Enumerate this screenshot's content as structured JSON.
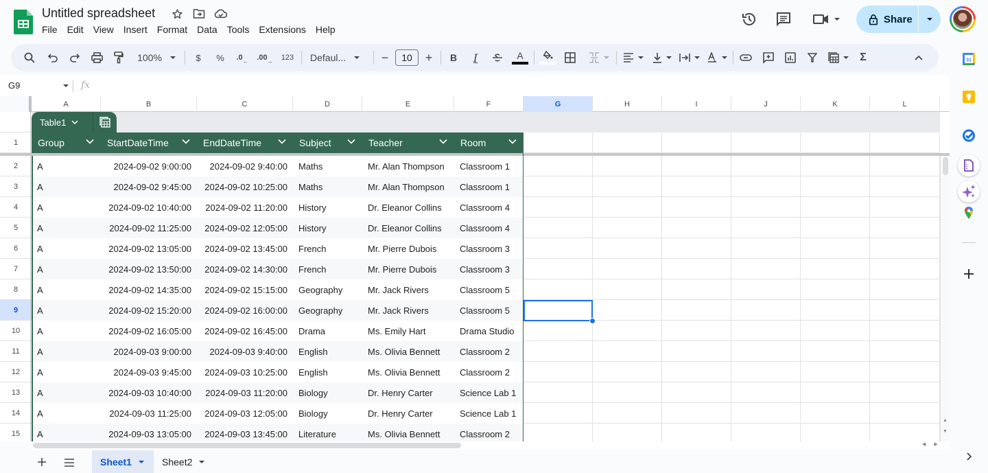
{
  "app": {
    "title": "Untitled spreadsheet",
    "menu": [
      "File",
      "Edit",
      "View",
      "Insert",
      "Format",
      "Data",
      "Tools",
      "Extensions",
      "Help"
    ],
    "share_label": "Share",
    "icons": [
      "sheets-logo-icon",
      "star-icon",
      "move-to-folder-icon",
      "cloud-saved-icon",
      "version-history-icon",
      "comments-icon",
      "meet-icon",
      "lock-icon",
      "avatar"
    ]
  },
  "toolbar": {
    "zoom": "100%",
    "currency": "$",
    "percent": "%",
    "decrease_decimal": ".0",
    "increase_decimal": ".00",
    "format_more": "123",
    "font": "Defaul...",
    "font_size": "10",
    "minus": "−",
    "plus": "+",
    "bold": "B",
    "italic": "I",
    "text_color": "A",
    "sum": "Σ"
  },
  "formula_bar": {
    "name_box": "G9",
    "fx": "fx",
    "value": ""
  },
  "grid": {
    "columns": [
      "A",
      "B",
      "C",
      "D",
      "E",
      "F",
      "G",
      "H",
      "I",
      "J",
      "K",
      "L"
    ],
    "selected_column": "G",
    "selected_row": "9",
    "selected_cell": "G9",
    "row_numbers": [
      "1",
      "2",
      "3",
      "4",
      "5",
      "6",
      "7",
      "8",
      "9",
      "10",
      "11",
      "12",
      "13",
      "14",
      "15"
    ],
    "table_name": "Table1",
    "table_color": "#356853",
    "headers": [
      "Group",
      "StartDateTime",
      "EndDateTime",
      "Subject",
      "Teacher",
      "Room"
    ],
    "rows": [
      [
        "A",
        "2024-09-02 9:00:00",
        "2024-09-02 9:40:00",
        "Maths",
        "Mr. Alan Thompson",
        "Classroom 1"
      ],
      [
        "A",
        "2024-09-02 9:45:00",
        "2024-09-02 10:25:00",
        "Maths",
        "Mr. Alan Thompson",
        "Classroom 1"
      ],
      [
        "A",
        "2024-09-02 10:40:00",
        "2024-09-02 11:20:00",
        "History",
        "Dr. Eleanor Collins",
        "Classroom 4"
      ],
      [
        "A",
        "2024-09-02 11:25:00",
        "2024-09-02 12:05:00",
        "History",
        "Dr. Eleanor Collins",
        "Classroom 4"
      ],
      [
        "A",
        "2024-09-02 13:05:00",
        "2024-09-02 13:45:00",
        "French",
        "Mr. Pierre Dubois",
        "Classroom 3"
      ],
      [
        "A",
        "2024-09-02 13:50:00",
        "2024-09-02 14:30:00",
        "French",
        "Mr. Pierre Dubois",
        "Classroom 3"
      ],
      [
        "A",
        "2024-09-02 14:35:00",
        "2024-09-02 15:15:00",
        "Geography",
        "Mr. Jack Rivers",
        "Classroom 5"
      ],
      [
        "A",
        "2024-09-02 15:20:00",
        "2024-09-02 16:00:00",
        "Geography",
        "Mr. Jack Rivers",
        "Classroom 5"
      ],
      [
        "A",
        "2024-09-02 16:05:00",
        "2024-09-02 16:45:00",
        "Drama",
        "Ms. Emily Hart",
        "Drama Studio"
      ],
      [
        "A",
        "2024-09-03 9:00:00",
        "2024-09-03 9:40:00",
        "English",
        "Ms. Olivia Bennett",
        "Classroom 2"
      ],
      [
        "A",
        "2024-09-03 9:45:00",
        "2024-09-03 10:25:00",
        "English",
        "Ms. Olivia Bennett",
        "Classroom 2"
      ],
      [
        "A",
        "2024-09-03 10:40:00",
        "2024-09-03 11:20:00",
        "Biology",
        "Dr. Henry Carter",
        "Science Lab 1"
      ],
      [
        "A",
        "2024-09-03 11:25:00",
        "2024-09-03 12:05:00",
        "Biology",
        "Dr. Henry Carter",
        "Science Lab 1"
      ],
      [
        "A",
        "2024-09-03 13:05:00",
        "2024-09-03 13:45:00",
        "Literature",
        "Ms. Olivia Bennett",
        "Classroom 2"
      ]
    ]
  },
  "sheets": {
    "tabs": [
      "Sheet1",
      "Sheet2"
    ],
    "active": "Sheet1"
  },
  "side_panel": {
    "apps": [
      "calendar-icon",
      "keep-icon",
      "tasks-icon",
      "forms-icon",
      "gemini-icon",
      "maps-icon",
      "add-icon"
    ]
  },
  "colors": {
    "accent": "#0b57d0",
    "share_bg": "#c2e7ff",
    "selection": "#1a73e8",
    "table_header": "#356853"
  }
}
